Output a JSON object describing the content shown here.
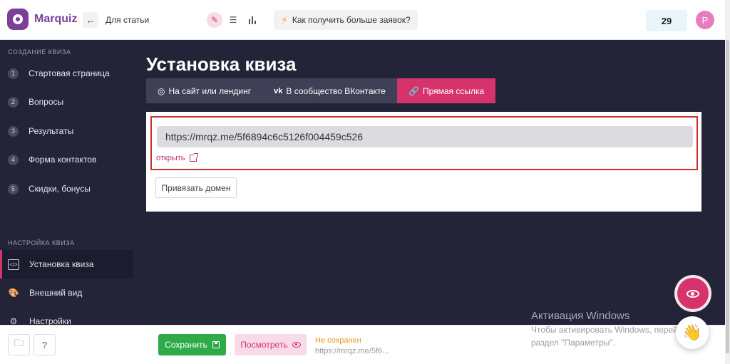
{
  "app": {
    "logo": "Marquiz",
    "breadcrumb": "Для статьи",
    "promo": "Как получить больше заявок?",
    "counter": "29",
    "avatar_letter": "P"
  },
  "sidebar": {
    "section1": "СОЗДАНИЕ КВИЗА",
    "steps": [
      {
        "num": "1",
        "label": "Стартовая страница"
      },
      {
        "num": "2",
        "label": "Вопросы"
      },
      {
        "num": "3",
        "label": "Результаты"
      },
      {
        "num": "4",
        "label": "Форма контактов"
      },
      {
        "num": "5",
        "label": "Скидки, бонусы"
      }
    ],
    "section2": "НАСТРОЙКА КВИЗА",
    "settings": [
      {
        "label": "Установка квиза",
        "icon": "code-icon",
        "active": true
      },
      {
        "label": "Внешний вид",
        "icon": "palette-icon"
      },
      {
        "label": "Настройки",
        "icon": "gear-icon"
      }
    ]
  },
  "main": {
    "title": "Установка квиза",
    "tabs": [
      {
        "label": "На сайт или лендинг",
        "icon": "chrome-icon"
      },
      {
        "label": "В сообщество ВКонтакте",
        "icon": "vk-icon"
      },
      {
        "label": "Прямая ссылка",
        "icon": "link-icon",
        "active": true
      }
    ],
    "url": "https://mrqz.me/5f6894c6c5126f004459c526",
    "open_label": "открыть",
    "domain_button": "Привязать домен"
  },
  "bottom": {
    "help": "?",
    "save": "Сохранить",
    "preview": "Посмотреть",
    "status": "Не сохранен",
    "status_url": "https://mrqz.me/5f6..."
  },
  "watermark": {
    "title": "Активация Windows",
    "line1": "Чтобы активировать Windows, перейдите в",
    "line2": "раздел \"Параметры\"."
  },
  "colors": {
    "accent": "#d6336c",
    "sidebar": "#232438",
    "save": "#2eaa48",
    "highlight": "#cc2e2e"
  }
}
